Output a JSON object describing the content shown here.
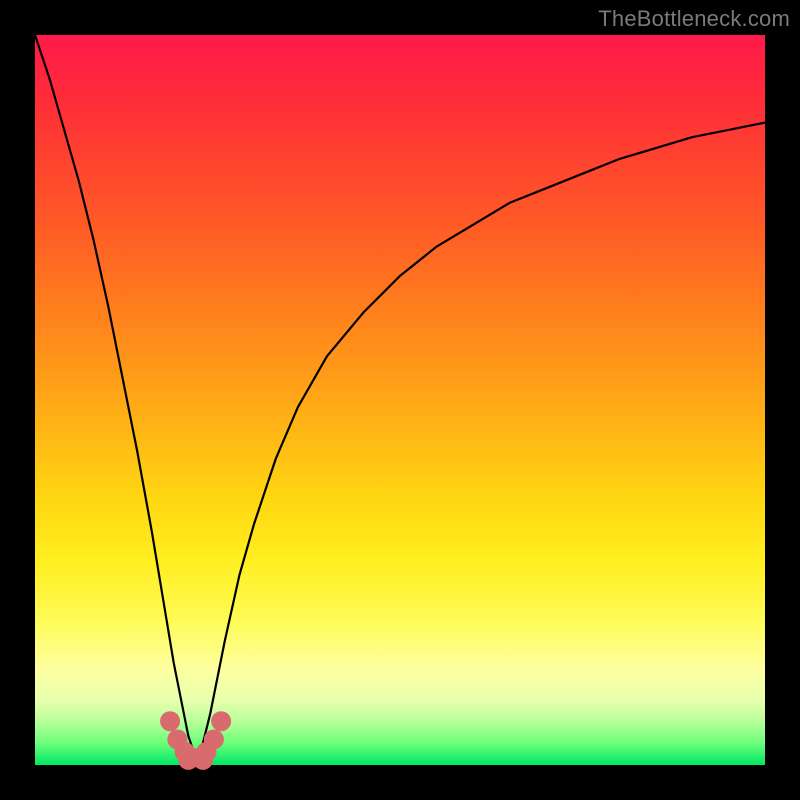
{
  "watermark": "TheBottleneck.com",
  "colors": {
    "frame_bg": "#000000",
    "dot": "#d96a6e",
    "curve": "#000000",
    "gradient_top": "#ff1a4b",
    "gradient_bottom": "#00e765"
  },
  "chart_data": {
    "type": "line",
    "title": "",
    "xlabel": "",
    "ylabel": "",
    "xlim": [
      0,
      100
    ],
    "ylim": [
      0,
      100
    ],
    "axes_visible": false,
    "grid": false,
    "description": "Bottleneck-style cusp curve. y represents bottleneck percentage (0 at bottom = no bottleneck, 100 at top). The curve drops steeply from top-left to a minimum near x≈22 then rises with decreasing slope toward the upper right.",
    "minimum_at_x": 22,
    "series": [
      {
        "name": "bottleneck-curve",
        "x": [
          0,
          2,
          4,
          6,
          8,
          10,
          12,
          14,
          16,
          18,
          19,
          20,
          21,
          22,
          23,
          24,
          25,
          26,
          28,
          30,
          33,
          36,
          40,
          45,
          50,
          55,
          60,
          65,
          70,
          75,
          80,
          85,
          90,
          95,
          100
        ],
        "y": [
          100,
          94,
          87,
          80,
          72,
          63,
          53,
          43,
          32,
          20,
          14,
          9,
          4,
          1,
          3,
          7,
          12,
          17,
          26,
          33,
          42,
          49,
          56,
          62,
          67,
          71,
          74,
          77,
          79,
          81,
          83,
          84.5,
          86,
          87,
          88
        ]
      }
    ],
    "marker_points": {
      "comment": "Salmon blob markers clustered around the cusp/minimum near the bottom of the curve",
      "x": [
        18.5,
        19.5,
        20.5,
        21.5,
        22.5,
        23.5,
        24.5,
        25.5,
        21.0,
        23.0
      ],
      "y": [
        6,
        3.5,
        1.8,
        1.0,
        1.0,
        1.8,
        3.5,
        6,
        0.7,
        0.7
      ]
    }
  }
}
